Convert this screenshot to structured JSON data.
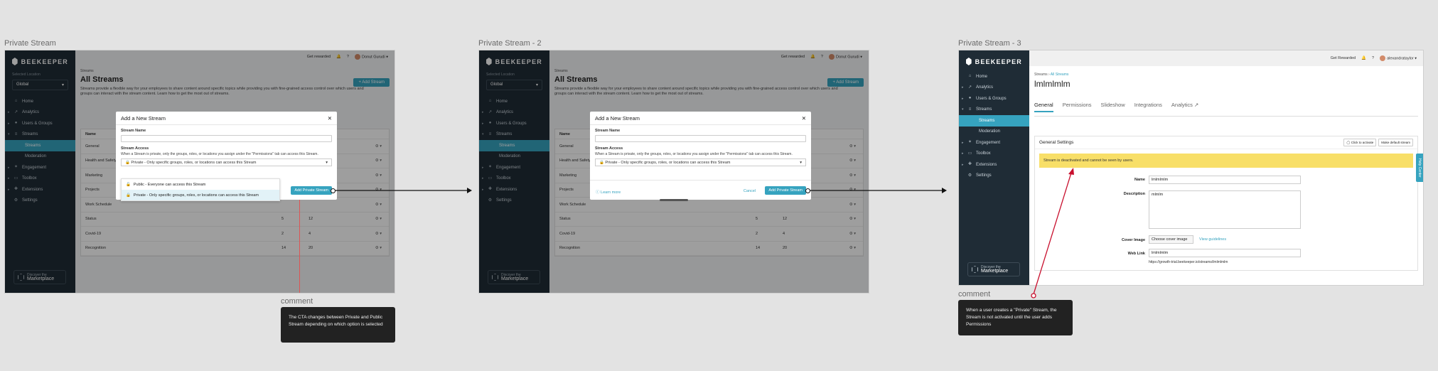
{
  "frames": [
    {
      "title": "Private Stream",
      "variant": "dropdown"
    },
    {
      "title": "Private Stream - 2",
      "variant": "closed"
    },
    {
      "title": "Private Stream - 3",
      "variant": "general"
    }
  ],
  "app": {
    "brand": "BEEKEEPER",
    "location_label": "Selected Location",
    "location_value": "Global",
    "nav": [
      {
        "label": "Home",
        "icon": "home-icon"
      },
      {
        "label": "Analytics",
        "icon": "analytics-icon"
      },
      {
        "label": "Users & Groups",
        "icon": "users-icon"
      },
      {
        "label": "Streams",
        "icon": "streams-icon"
      }
    ],
    "nav_sub": [
      "Streams",
      "Moderation"
    ],
    "nav_bottom": [
      {
        "label": "Engagement",
        "icon": "engagement-icon"
      },
      {
        "label": "Toolbox",
        "icon": "toolbox-icon"
      },
      {
        "label": "Extensions",
        "icon": "extensions-icon"
      },
      {
        "label": "Settings",
        "icon": "settings-icon"
      }
    ],
    "marketplace_small": "Discover the",
    "marketplace_big": "Marketplace"
  },
  "topbar": {
    "rewards": "Get rewarded",
    "user": "Donut Gurudi"
  },
  "topbar3": {
    "rewards": "Get Rewarded",
    "user": "alexandrataylor"
  },
  "streams_page": {
    "crumb": "Streams",
    "title": "All Streams",
    "description": "Streams provide a flexible way for your employees to share content around specific topics while providing you with fine-grained access control over which users and groups can interact with the stream content. Learn how to get the most out of streams.",
    "add_button": "+ Add Stream",
    "name_header": "Name",
    "rows": [
      {
        "name": "General",
        "a": "",
        "b": ""
      },
      {
        "name": "Health and Safety",
        "a": "",
        "b": ""
      },
      {
        "name": "Marketing",
        "a": "",
        "b": ""
      },
      {
        "name": "Projects",
        "a": "",
        "b": ""
      },
      {
        "name": "Work Schedule",
        "a": "",
        "b": ""
      },
      {
        "name": "Status",
        "a": "5",
        "b": "12"
      },
      {
        "name": "Covid-19",
        "a": "2",
        "b": "4"
      },
      {
        "name": "Recognition",
        "a": "14",
        "b": "20"
      }
    ]
  },
  "modal": {
    "title": "Add a New Stream",
    "name_label": "Stream Name",
    "access_label": "Stream Access",
    "access_help": "When a Stream is private, only the groups, roles, or locations you assign under the \"Permissions\" tab can access this Stream.",
    "selected": "Private - Only specific groups, roles, or locations can access this Stream",
    "options": [
      "Public - Everyone can access this Stream",
      "Private - Only specific groups, roles, or locations can access this Stream"
    ],
    "primary": "Add Private Stream",
    "cancel": "Cancel",
    "learn": "Learn more"
  },
  "stream3": {
    "crumb_root": "Streams",
    "crumb_link": "All Streams",
    "title": "lmlmlmlm",
    "tabs": [
      "General",
      "Permissions",
      "Slideshow",
      "Integrations",
      "Analytics"
    ],
    "card_title": "General Settings",
    "btn_activate": "Click to activate",
    "btn_default": "Make default stream",
    "warning": "Stream is deactivated and cannot be seen by users.",
    "name_label": "Name",
    "name_value": "lmlmlmlm",
    "desc_label": "Description",
    "desc_value": "mlmlm",
    "cover_label": "Cover Image",
    "cover_btn": "Choose cover image",
    "cover_link": "View guidelines",
    "weblink_label": "Web Link",
    "weblink_value": "lmlmlmlm",
    "weblink_url": "https://growth-trial.beekeeper.io/streams/lmlmlmlm",
    "help": "Help Center"
  },
  "comments": [
    {
      "label": "comment",
      "text": "The CTA changes between Private and Public Stream depending on which option is selected"
    },
    {
      "label": "comment",
      "text": "When a user creates a \"Private\" Stream, the Stream is not activated until the user adds Permissions"
    }
  ],
  "colors": {
    "accent": "#36a3bf",
    "sidebar": "#1f2c36",
    "warning": "#f8df68"
  }
}
